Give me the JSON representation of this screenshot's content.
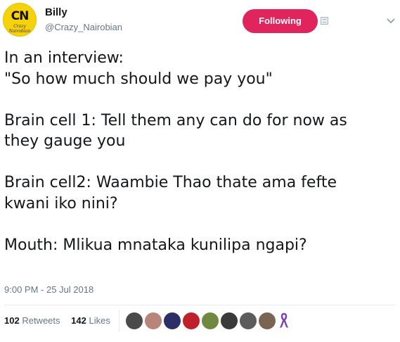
{
  "user": {
    "name": "Billy",
    "handle": "@Crazy_Nairobian",
    "avatar_monogram": "CN",
    "avatar_script": "Crazy Nairobian",
    "follow_button_label": "Following"
  },
  "tweet": {
    "text": "In an interview:\n\"So how much should we pay you\"\n\nBrain cell 1: Tell them any can do for now as\nthey gauge you\n\nBrain cell2: Waambie Thao thate ama fefte\nkwani iko nini?\n\nMouth: Mlikua mnataka kunilipa ngapi?",
    "timestamp": "9:00 PM - 25 Jul 2018"
  },
  "stats": {
    "retweets_count": "102",
    "retweets_label": "Retweets",
    "likes_count": "142",
    "likes_label": "Likes"
  },
  "colors": {
    "follow_button": "#e0245e",
    "secondary_text": "#657786",
    "primary_text": "#14171a",
    "ribbon": "#7a45b5"
  },
  "likers": [
    {
      "icon": "avatar-dark-man",
      "color": "#4a4a4a"
    },
    {
      "icon": "avatar-woman",
      "color": "#b9857a"
    },
    {
      "icon": "avatar-blue-graphic",
      "color": "#2b2f66"
    },
    {
      "icon": "avatar-red-logo",
      "color": "#c0202a"
    },
    {
      "icon": "avatar-green-figure",
      "color": "#6f8a3e"
    },
    {
      "icon": "avatar-dark-face",
      "color": "#3a3a3a"
    },
    {
      "icon": "avatar-man-bw",
      "color": "#5c5c5c"
    },
    {
      "icon": "avatar-selfie",
      "color": "#7a6553"
    },
    {
      "icon": "purple-ribbon-icon",
      "color": "#7a45b5"
    }
  ]
}
